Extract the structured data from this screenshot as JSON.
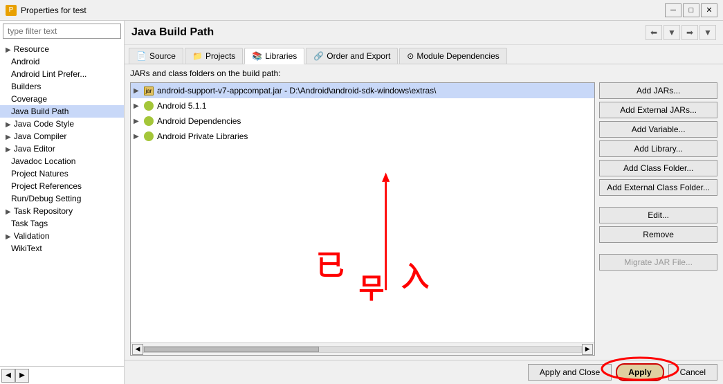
{
  "titlebar": {
    "icon": "P",
    "title": "Properties for test",
    "minimize": "─",
    "maximize": "□",
    "close": "✕"
  },
  "sidebar": {
    "filter_placeholder": "type filter text",
    "items": [
      {
        "id": "resource",
        "label": "Resource",
        "arrow": "▶",
        "indent": false
      },
      {
        "id": "android",
        "label": "Android",
        "arrow": "",
        "indent": true
      },
      {
        "id": "android-lint",
        "label": "Android Lint Prefer...",
        "arrow": "",
        "indent": true
      },
      {
        "id": "builders",
        "label": "Builders",
        "arrow": "",
        "indent": true
      },
      {
        "id": "coverage",
        "label": "Coverage",
        "arrow": "",
        "indent": true
      },
      {
        "id": "java-build-path",
        "label": "Java Build Path",
        "arrow": "",
        "indent": true,
        "selected": true
      },
      {
        "id": "java-code-style",
        "label": "Java Code Style",
        "arrow": "▶",
        "indent": false
      },
      {
        "id": "java-compiler",
        "label": "Java Compiler",
        "arrow": "▶",
        "indent": false
      },
      {
        "id": "java-editor",
        "label": "Java Editor",
        "arrow": "▶",
        "indent": false
      },
      {
        "id": "javadoc-location",
        "label": "Javadoc Location",
        "arrow": "",
        "indent": true
      },
      {
        "id": "project-natures",
        "label": "Project Natures",
        "arrow": "",
        "indent": true
      },
      {
        "id": "project-references",
        "label": "Project References",
        "arrow": "",
        "indent": true
      },
      {
        "id": "run-debug",
        "label": "Run/Debug Setting",
        "arrow": "",
        "indent": true
      },
      {
        "id": "task-repository",
        "label": "Task Repository",
        "arrow": "▶",
        "indent": false
      },
      {
        "id": "task-tags",
        "label": "Task Tags",
        "arrow": "",
        "indent": true
      },
      {
        "id": "validation",
        "label": "Validation",
        "arrow": "▶",
        "indent": false
      },
      {
        "id": "wikitext",
        "label": "WikiText",
        "arrow": "",
        "indent": true
      }
    ]
  },
  "content": {
    "title": "Java Build Path",
    "description": "JARs and class folders on the build path:",
    "tabs": [
      {
        "id": "source",
        "label": "Source",
        "icon": "📄"
      },
      {
        "id": "projects",
        "label": "Projects",
        "icon": "📁"
      },
      {
        "id": "libraries",
        "label": "Libraries",
        "icon": "📚",
        "active": true
      },
      {
        "id": "order-export",
        "label": "Order and Export",
        "icon": "🔗"
      },
      {
        "id": "module-deps",
        "label": "Module Dependencies",
        "icon": "⊙"
      }
    ],
    "tree_items": [
      {
        "id": "item1",
        "label": "android-support-v7-appcompat.jar - D:\\Android\\android-sdk-windows\\extras\\",
        "icon": "jar",
        "arrow": "▶",
        "selected": true
      },
      {
        "id": "item2",
        "label": "Android 5.1.1",
        "icon": "android",
        "arrow": "▶"
      },
      {
        "id": "item3",
        "label": "Android Dependencies",
        "icon": "android",
        "arrow": "▶"
      },
      {
        "id": "item4",
        "label": "Android Private Libraries",
        "icon": "android",
        "arrow": "▶"
      }
    ],
    "buttons": [
      {
        "id": "add-jars",
        "label": "Add JARs...",
        "disabled": false
      },
      {
        "id": "add-external-jars",
        "label": "Add External JARs...",
        "disabled": false
      },
      {
        "id": "add-variable",
        "label": "Add Variable...",
        "disabled": false
      },
      {
        "id": "add-library",
        "label": "Add Library...",
        "disabled": false
      },
      {
        "id": "add-class-folder",
        "label": "Add Class Folder...",
        "disabled": false
      },
      {
        "id": "add-external-class-folder",
        "label": "Add External Class Folder...",
        "disabled": false
      },
      {
        "id": "edit",
        "label": "Edit...",
        "disabled": false
      },
      {
        "id": "remove",
        "label": "Remove",
        "disabled": false
      },
      {
        "id": "migrate-jar",
        "label": "Migrate JAR File...",
        "disabled": true
      }
    ],
    "bottom_buttons": [
      {
        "id": "apply-close",
        "label": "Apply and Close"
      },
      {
        "id": "apply",
        "label": "Apply",
        "special": true
      },
      {
        "id": "cancel",
        "label": "Cancel"
      }
    ]
  }
}
